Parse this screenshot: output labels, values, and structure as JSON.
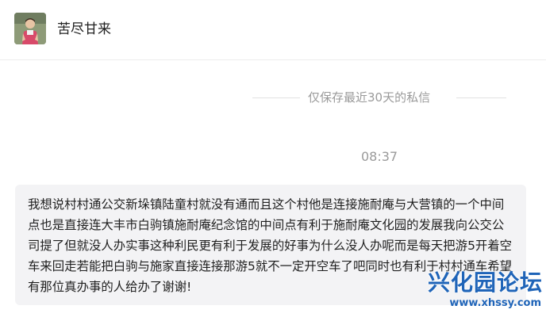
{
  "header": {
    "title": "苦尽甘来",
    "avatar_icon": "user-avatar-photo"
  },
  "chat": {
    "notice": "仅保存最近30天的私信",
    "time": "08:37",
    "message": "我想说村村通公交新垛镇陆童村就没有通而且这个村他是连接施耐庵与大营镇的一个中间点也是直接连大丰市白驹镇施耐庵纪念馆的中间点有利于施耐庵文化园的发展我向公交公司提了但就没人办实事这种利民更有利于发展的好事为什么没人办呢而是每天把游5开着空车来回走若能把白驹与施家直接连接那游5就不一定开空车了吧同时也有利于村村通车希望有那位真办事的人给办了谢谢!"
  },
  "watermark": {
    "text": "兴化园论坛",
    "url": "www.xhssy.com"
  },
  "colors": {
    "bubble_bg": "#f3f3f5",
    "meta_text": "#9a9a9a",
    "watermark": "#1f64b8"
  }
}
